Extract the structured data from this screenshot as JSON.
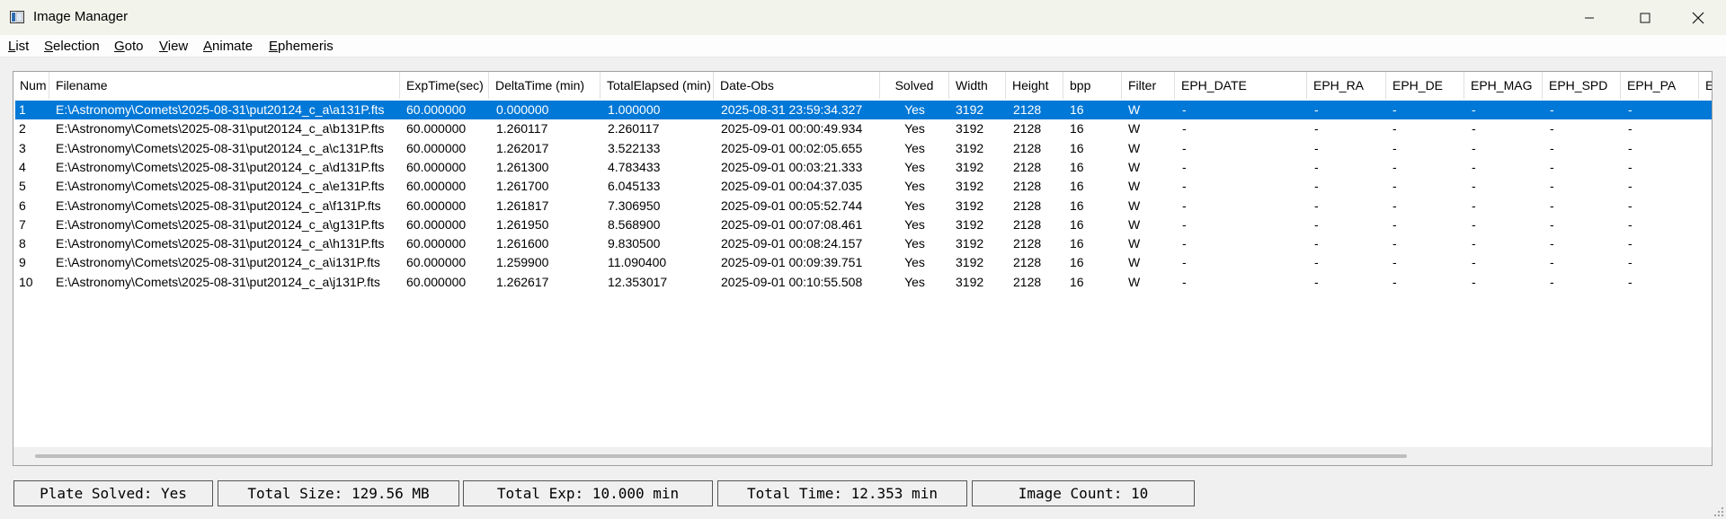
{
  "window": {
    "title": "Image Manager"
  },
  "menu": [
    {
      "label": "List"
    },
    {
      "label": "Selection"
    },
    {
      "label": "Goto"
    },
    {
      "label": "View"
    },
    {
      "label": "Animate"
    },
    {
      "label": "Ephemeris"
    }
  ],
  "table": {
    "columns": [
      "Num",
      "Filename",
      "ExpTime(sec)",
      "DeltaTime (min)",
      "TotalElapsed (min)",
      "Date-Obs",
      "Solved",
      "Width",
      "Height",
      "bpp",
      "Filter",
      "EPH_DATE",
      "EPH_RA",
      "EPH_DE",
      "EPH_MAG",
      "EPH_SPD",
      "EPH_PA",
      "E"
    ],
    "selected_index": 0,
    "rows": [
      [
        "1",
        "E:\\Astronomy\\Comets\\2025-08-31\\put20124_c_a\\a131P.fts",
        "60.000000",
        "0.000000",
        "1.000000",
        "2025-08-31 23:59:34.327",
        "Yes",
        "3192",
        "2128",
        "16",
        "W",
        "-",
        "-",
        "-",
        "-",
        "-",
        "-"
      ],
      [
        "2",
        "E:\\Astronomy\\Comets\\2025-08-31\\put20124_c_a\\b131P.fts",
        "60.000000",
        "1.260117",
        "2.260117",
        "2025-09-01 00:00:49.934",
        "Yes",
        "3192",
        "2128",
        "16",
        "W",
        "-",
        "-",
        "-",
        "-",
        "-",
        "-"
      ],
      [
        "3",
        "E:\\Astronomy\\Comets\\2025-08-31\\put20124_c_a\\c131P.fts",
        "60.000000",
        "1.262017",
        "3.522133",
        "2025-09-01 00:02:05.655",
        "Yes",
        "3192",
        "2128",
        "16",
        "W",
        "-",
        "-",
        "-",
        "-",
        "-",
        "-"
      ],
      [
        "4",
        "E:\\Astronomy\\Comets\\2025-08-31\\put20124_c_a\\d131P.fts",
        "60.000000",
        "1.261300",
        "4.783433",
        "2025-09-01 00:03:21.333",
        "Yes",
        "3192",
        "2128",
        "16",
        "W",
        "-",
        "-",
        "-",
        "-",
        "-",
        "-"
      ],
      [
        "5",
        "E:\\Astronomy\\Comets\\2025-08-31\\put20124_c_a\\e131P.fts",
        "60.000000",
        "1.261700",
        "6.045133",
        "2025-09-01 00:04:37.035",
        "Yes",
        "3192",
        "2128",
        "16",
        "W",
        "-",
        "-",
        "-",
        "-",
        "-",
        "-"
      ],
      [
        "6",
        "E:\\Astronomy\\Comets\\2025-08-31\\put20124_c_a\\f131P.fts",
        "60.000000",
        "1.261817",
        "7.306950",
        "2025-09-01 00:05:52.744",
        "Yes",
        "3192",
        "2128",
        "16",
        "W",
        "-",
        "-",
        "-",
        "-",
        "-",
        "-"
      ],
      [
        "7",
        "E:\\Astronomy\\Comets\\2025-08-31\\put20124_c_a\\g131P.fts",
        "60.000000",
        "1.261950",
        "8.568900",
        "2025-09-01 00:07:08.461",
        "Yes",
        "3192",
        "2128",
        "16",
        "W",
        "-",
        "-",
        "-",
        "-",
        "-",
        "-"
      ],
      [
        "8",
        "E:\\Astronomy\\Comets\\2025-08-31\\put20124_c_a\\h131P.fts",
        "60.000000",
        "1.261600",
        "9.830500",
        "2025-09-01 00:08:24.157",
        "Yes",
        "3192",
        "2128",
        "16",
        "W",
        "-",
        "-",
        "-",
        "-",
        "-",
        "-"
      ],
      [
        "9",
        "E:\\Astronomy\\Comets\\2025-08-31\\put20124_c_a\\i131P.fts",
        "60.000000",
        "1.259900",
        "11.090400",
        "2025-09-01 00:09:39.751",
        "Yes",
        "3192",
        "2128",
        "16",
        "W",
        "-",
        "-",
        "-",
        "-",
        "-",
        "-"
      ],
      [
        "10",
        "E:\\Astronomy\\Comets\\2025-08-31\\put20124_c_a\\j131P.fts",
        "60.000000",
        "1.262617",
        "12.353017",
        "2025-09-01 00:10:55.508",
        "Yes",
        "3192",
        "2128",
        "16",
        "W",
        "-",
        "-",
        "-",
        "-",
        "-",
        "-"
      ]
    ]
  },
  "status": {
    "plate_solved": "Plate Solved: Yes",
    "total_size": "Total Size: 129.56 MB",
    "total_exp": "Total Exp: 10.000 min",
    "total_time": "Total Time: 12.353 min",
    "image_count": "Image Count: 10"
  },
  "colors": {
    "selection": "#0078d7",
    "titlebar": "#f2f3ea"
  },
  "icons": [
    "app-icon",
    "minimize-icon",
    "maximize-icon",
    "close-icon",
    "resize-grip-icon"
  ]
}
